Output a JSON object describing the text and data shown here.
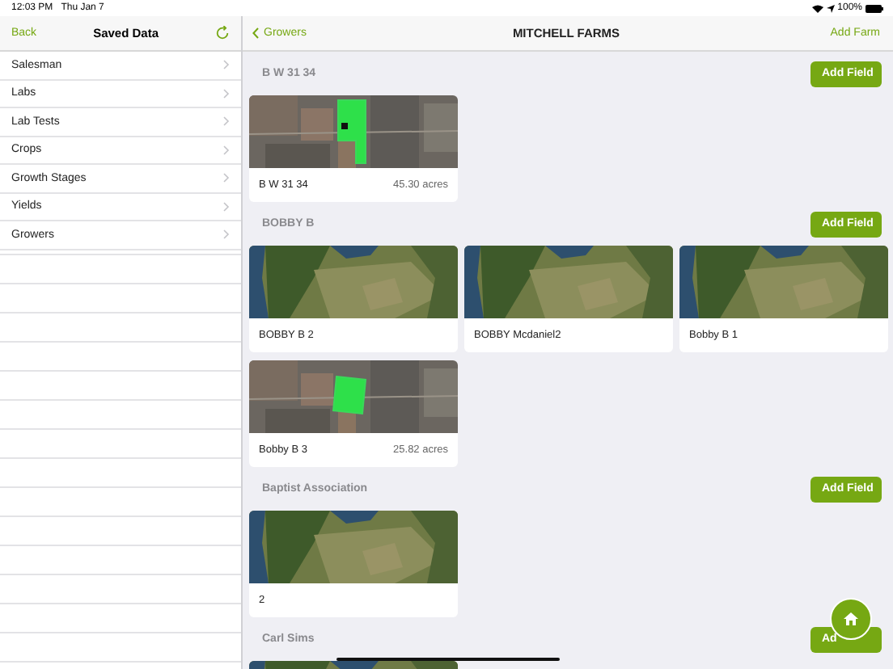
{
  "status_bar": {
    "time": "12:03 PM",
    "date": "Thu Jan 7",
    "battery": "100%"
  },
  "sidebar": {
    "back": "Back",
    "title": "Saved Data",
    "items": [
      {
        "label": "Salesman"
      },
      {
        "label": "Labs"
      },
      {
        "label": "Lab Tests"
      },
      {
        "label": "Crops"
      },
      {
        "label": "Growth Stages"
      },
      {
        "label": "Yields"
      },
      {
        "label": "Growers"
      }
    ]
  },
  "nav": {
    "back": "Growers",
    "title": "MITCHELL FARMS",
    "action": "Add Farm"
  },
  "sections": [
    {
      "title": "B W 31 34",
      "button": "Add Field",
      "fields": [
        {
          "name": "B W 31 34",
          "acres": "45.30 acres"
        }
      ]
    },
    {
      "title": "BOBBY B",
      "button": "Add Field",
      "fields": [
        {
          "name": "BOBBY B 2"
        },
        {
          "name": "BOBBY Mcdaniel2"
        },
        {
          "name": "Bobby B 1"
        },
        {
          "name": "Bobby B 3",
          "acres": "25.82 acres"
        }
      ]
    },
    {
      "title": "Baptist Association",
      "button": "Add Field",
      "fields": [
        {
          "name": "2"
        }
      ]
    },
    {
      "title": "Carl Sims",
      "button": "Ad"
    }
  ]
}
